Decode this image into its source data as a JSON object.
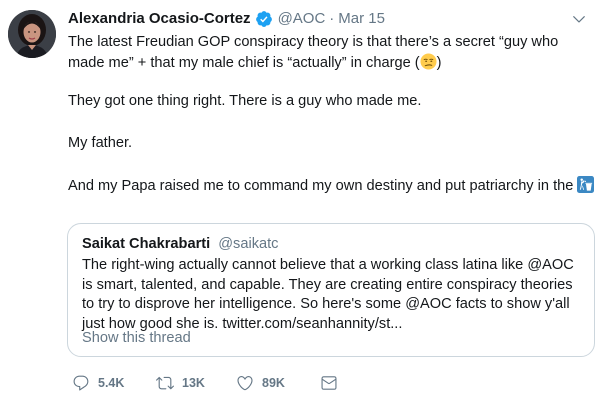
{
  "tweet": {
    "author": {
      "name": "Alexandria Ocasio-Cortez",
      "handle": "@AOC",
      "separator": "·",
      "timestamp": "Mar 15",
      "verified": true
    },
    "paragraphs": {
      "p1_before_emoji": "The latest Freudian GOP conspiracy theory is that there’s a secret “guy who made me” + that my male chief is “actually” in charge (",
      "p1_after_emoji": ")",
      "p2": "They got one thing right. There is a guy who made me.",
      "p3": "My father.",
      "p4": "And my Papa raised me to command my own destiny and put patriarchy in the "
    },
    "emojis": [
      "unamused-face-emoji",
      "trash-can-put-litter-emoji"
    ],
    "quoted_tweet": {
      "name": "Saikat Chakrabarti",
      "handle": "@saikatc",
      "text": "The right-wing actually cannot believe that a working class latina like @AOC is smart, talented, and capable. They are creating entire conspiracy theories to try to disprove her intelligence. So here's some @AOC facts to show y'all just how good she is. twitter.com/seanhannity/st...",
      "show_thread": "Show this thread"
    },
    "actions": {
      "replies": "5.4K",
      "retweets": "13K",
      "likes": "89K"
    }
  },
  "colors": {
    "primary_text": "#14171a",
    "secondary_text": "#657786",
    "verified_blue": "#1da1f2",
    "border": "#ccd6dd"
  }
}
